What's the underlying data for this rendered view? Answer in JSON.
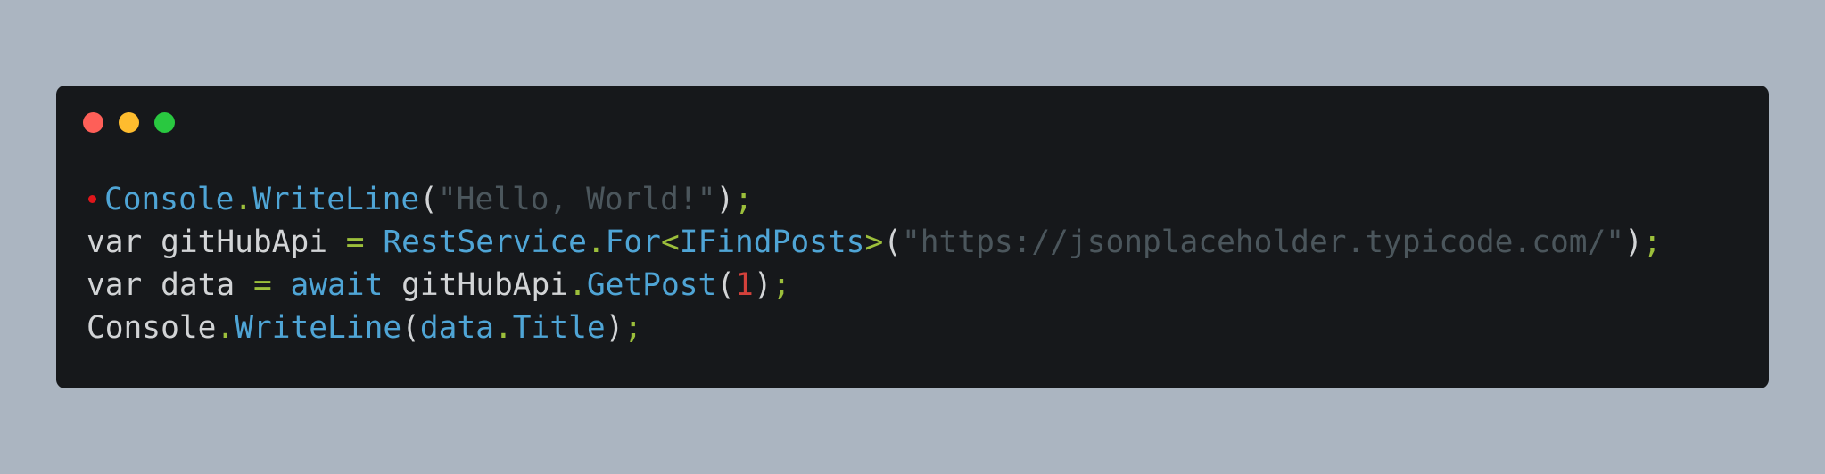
{
  "window": {
    "controls": [
      {
        "name": "close",
        "color": "#fe5f58"
      },
      {
        "name": "minimize",
        "color": "#febc2e"
      },
      {
        "name": "maximize",
        "color": "#29c840"
      }
    ],
    "breakpoint_marker": {
      "line": 1,
      "color": "#e0161b"
    }
  },
  "colors": {
    "background": "#abb5c1",
    "editor": "#16181b",
    "text": "#d2d4d6",
    "identifier": "#4fa5d6",
    "string": "#4b565c",
    "number": "#d3413b",
    "punctuation": "#9cbf3b"
  },
  "code": {
    "lines": [
      [
        {
          "t": "Console",
          "k": "identifier"
        },
        {
          "t": ".",
          "k": "punctuation"
        },
        {
          "t": "WriteLine",
          "k": "identifier"
        },
        {
          "t": "(",
          "k": "text"
        },
        {
          "t": "\"Hello, World!\"",
          "k": "string"
        },
        {
          "t": ")",
          "k": "text"
        },
        {
          "t": ";",
          "k": "punctuation"
        }
      ],
      [
        {
          "t": "var gitHubApi ",
          "k": "text"
        },
        {
          "t": "=",
          "k": "punctuation"
        },
        {
          "t": " ",
          "k": "text"
        },
        {
          "t": "RestService",
          "k": "identifier"
        },
        {
          "t": ".",
          "k": "punctuation"
        },
        {
          "t": "For",
          "k": "identifier"
        },
        {
          "t": "<",
          "k": "punctuation"
        },
        {
          "t": "IFindPosts",
          "k": "identifier"
        },
        {
          "t": ">",
          "k": "punctuation"
        },
        {
          "t": "(",
          "k": "text"
        },
        {
          "t": "\"https://jsonplaceholder.typicode.com/\"",
          "k": "string"
        },
        {
          "t": ")",
          "k": "text"
        },
        {
          "t": ";",
          "k": "punctuation"
        }
      ],
      [
        {
          "t": "var data ",
          "k": "text"
        },
        {
          "t": "=",
          "k": "punctuation"
        },
        {
          "t": " ",
          "k": "text"
        },
        {
          "t": "await",
          "k": "identifier"
        },
        {
          "t": " gitHubApi",
          "k": "text"
        },
        {
          "t": ".",
          "k": "punctuation"
        },
        {
          "t": "GetPost",
          "k": "identifier"
        },
        {
          "t": "(",
          "k": "text"
        },
        {
          "t": "1",
          "k": "number"
        },
        {
          "t": ")",
          "k": "text"
        },
        {
          "t": ";",
          "k": "punctuation"
        }
      ],
      [
        {
          "t": "Console",
          "k": "text"
        },
        {
          "t": ".",
          "k": "punctuation"
        },
        {
          "t": "WriteLine",
          "k": "identifier"
        },
        {
          "t": "(",
          "k": "text"
        },
        {
          "t": "data",
          "k": "identifier"
        },
        {
          "t": ".",
          "k": "punctuation"
        },
        {
          "t": "Title",
          "k": "identifier"
        },
        {
          "t": ")",
          "k": "text"
        },
        {
          "t": ";",
          "k": "punctuation"
        }
      ]
    ]
  }
}
